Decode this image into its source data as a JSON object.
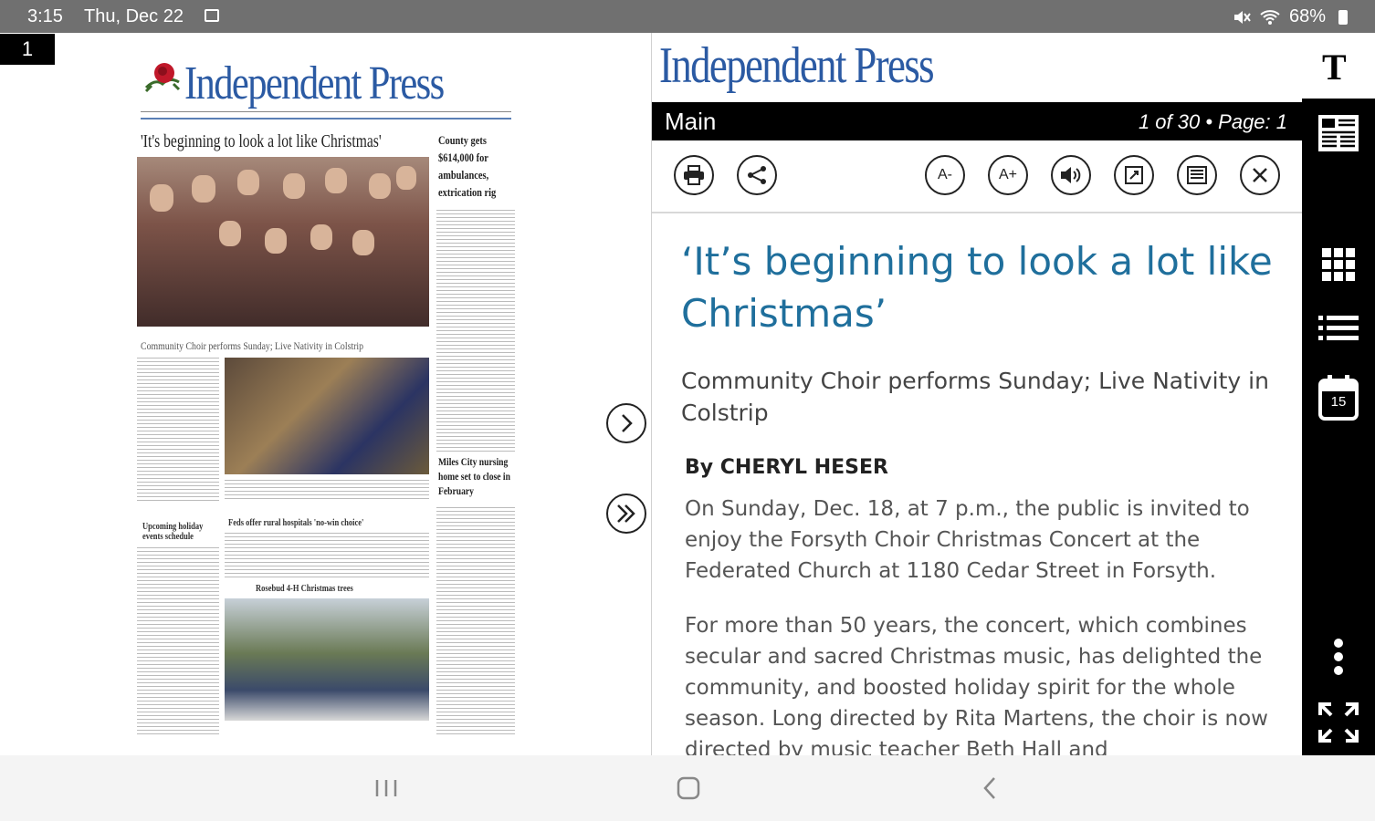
{
  "status_bar": {
    "time": "3:15",
    "date": "Thu, Dec 22",
    "battery": "68%"
  },
  "page_badge": "1",
  "thumbnail": {
    "masthead": "Independent Press",
    "headline": "'It's beginning to look a lot like Christmas'",
    "photo_caption": "Community Choir performs Sunday; Live Nativity in Colstrip",
    "side_headline_1": "County gets $614,000 for ambulances, extrication rig",
    "side_headline_2": "Miles City nursing home set to close in February",
    "lower_head_left": "Upcoming holiday events schedule",
    "lower_head_mid": "Feds offer rural hospitals 'no-win choice'",
    "lower_head_photo": "Rosebud 4-H Christmas trees"
  },
  "reader": {
    "logo": "Independent Press",
    "text_icon": "T",
    "section": "Main",
    "page_info": "1 of 30 • Page: 1",
    "tools": {
      "font_decrease": "A-",
      "font_increase": "A+"
    },
    "article": {
      "title": "‘It’s beginning to look a lot like Christmas’",
      "subtitle": "Community Choir performs Sunday; Live Nativity in Colstrip",
      "byline": "By CHERYL HESER",
      "para1": "On Sunday, Dec. 18, at 7 p.m., the public is invited to enjoy the Forsyth Choir Christmas Concert at the Federated Church at 1180 Cedar Street in Forsyth.",
      "para2": "For more than 50 years, the concert, which combines secular and sacred Christmas music, has delighted the community, and boosted holiday spirit for the whole season. Long directed by Rita Martens, the choir is now directed by music teacher Beth Hall and"
    }
  },
  "rail": {
    "calendar_day": "15"
  },
  "colors": {
    "accent_blue": "#2b5aa3",
    "title_teal": "#1f6f9c",
    "rail_black": "#000000"
  }
}
